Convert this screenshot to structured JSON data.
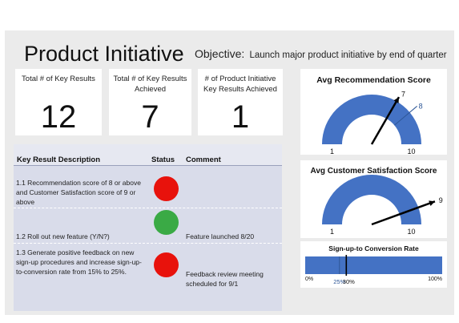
{
  "header": {
    "title": "Product Initiative",
    "objective_label": "Objective:",
    "objective_text": "Launch major product initiative by end of quarter"
  },
  "kpis": [
    {
      "label": "Total # of Key Results",
      "value": "12"
    },
    {
      "label": "Total # of Key Results Achieved",
      "value": "7"
    },
    {
      "label": "# of Product Initiative Key Results Achieved",
      "value": "1"
    }
  ],
  "table": {
    "headers": {
      "description": "Key Result Description",
      "status": "Status",
      "comment": "Comment"
    },
    "rows": [
      {
        "description": "1.1 Recommendation score of 8 or above and Customer Satisfaction score of 9 or above",
        "status": "red",
        "comment": ""
      },
      {
        "description": "1.2 Roll out new feature (Y/N?)",
        "status": "green",
        "comment": "Feature launched 8/20"
      },
      {
        "description": "1.3 Generate positive feedback on new sign-up procedures and increase sign-up-to-conversion rate from 15% to 25%.",
        "status": "red",
        "comment": "Feedback review meeting scheduled for 9/1"
      }
    ]
  },
  "colors": {
    "red": "#e8120c",
    "green": "#3aaa45",
    "gauge": "#4472c4",
    "target": "#2e5797"
  },
  "gauges": [
    {
      "title": "Avg Recommendation Score",
      "min": 1,
      "max": 10,
      "min_label": "1",
      "max_label": "10",
      "value": 7,
      "value_label": "7",
      "target": 8,
      "target_label": "8"
    },
    {
      "title": "Avg Customer Satisfaction Score",
      "min": 1,
      "max": 10,
      "min_label": "1",
      "max_label": "10",
      "value": 9,
      "value_label": "9"
    }
  ],
  "conversion": {
    "title": "Sign-up-to Conversion Rate",
    "min_label": "0%",
    "max_label": "100%",
    "target": 25,
    "target_label": "25%",
    "value": 30,
    "value_label": "30%"
  }
}
